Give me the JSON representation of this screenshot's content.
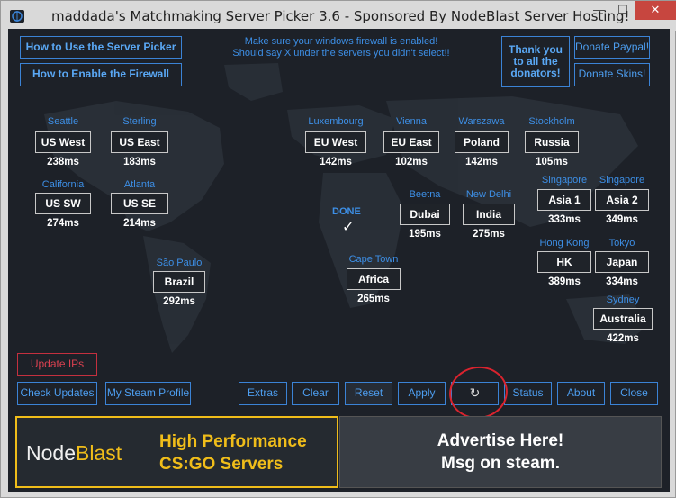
{
  "window": {
    "title": "maddada's Matchmaking Server Picker 3.6 - Sponsored By NodeBlast Server Hosting!",
    "minimize_glyph": "—",
    "maximize_glyph": "☐",
    "close_glyph": "✕"
  },
  "header": {
    "how_to_use": "How to Use the Server Picker",
    "how_to_firewall": "How to Enable the Firewall",
    "notice_line1": "Make sure your windows firewall is enabled!",
    "notice_line2": "Should say X under the servers you didn't select!!",
    "thanks": "Thank you to all the donators!",
    "donate_paypal": "Donate Paypal!",
    "donate_skins": "Donate Skins!"
  },
  "servers": [
    {
      "city": "Seattle",
      "name": "US West",
      "ping": "238ms"
    },
    {
      "city": "Sterling",
      "name": "US East",
      "ping": "183ms"
    },
    {
      "city": "California",
      "name": "US SW",
      "ping": "274ms"
    },
    {
      "city": "Atlanta",
      "name": "US SE",
      "ping": "214ms"
    },
    {
      "city": "São Paulo",
      "name": "Brazil",
      "ping": "292ms"
    },
    {
      "city": "Luxembourg",
      "name": "EU West",
      "ping": "142ms"
    },
    {
      "city": "Vienna",
      "name": "EU East",
      "ping": "102ms"
    },
    {
      "city": "Warszawa",
      "name": "Poland",
      "ping": "142ms"
    },
    {
      "city": "Stockholm",
      "name": "Russia",
      "ping": "105ms"
    },
    {
      "city": "Beetna",
      "name": "Dubai",
      "ping": "195ms"
    },
    {
      "city": "New Delhi",
      "name": "India",
      "ping": "275ms"
    },
    {
      "city": "Cape Town",
      "name": "Africa",
      "ping": "265ms"
    },
    {
      "city": "Singapore",
      "name": "Asia 1",
      "ping": "333ms"
    },
    {
      "city": "Singapore",
      "name": "Asia 2",
      "ping": "349ms"
    },
    {
      "city": "Hong Kong",
      "name": "HK",
      "ping": "389ms"
    },
    {
      "city": "Tokyo",
      "name": "Japan",
      "ping": "334ms"
    },
    {
      "city": "Sydney",
      "name": "Australia",
      "ping": "422ms"
    }
  ],
  "status": {
    "done_label": "DONE",
    "done_glyph": "✓"
  },
  "footer": {
    "update_ips": "Update IPs",
    "check_updates": "Check Updates",
    "steam_profile": "My Steam Profile",
    "extras": "Extras",
    "clear": "Clear",
    "reset": "Reset",
    "apply": "Apply",
    "refresh_glyph": "↻",
    "status": "Status",
    "about": "About",
    "close": "Close"
  },
  "ads": {
    "nodeblast_node": "Node",
    "nodeblast_blast": "Blast",
    "tagline1": "High Performance",
    "tagline2": "CS:GO Servers",
    "advertise1": "Advertise Here!",
    "advertise2": "Msg on steam."
  },
  "colors": {
    "accent": "#3b83d6",
    "background": "#1d2128",
    "sponsor_gold": "#f0bd1a",
    "alert": "#c4303f"
  }
}
